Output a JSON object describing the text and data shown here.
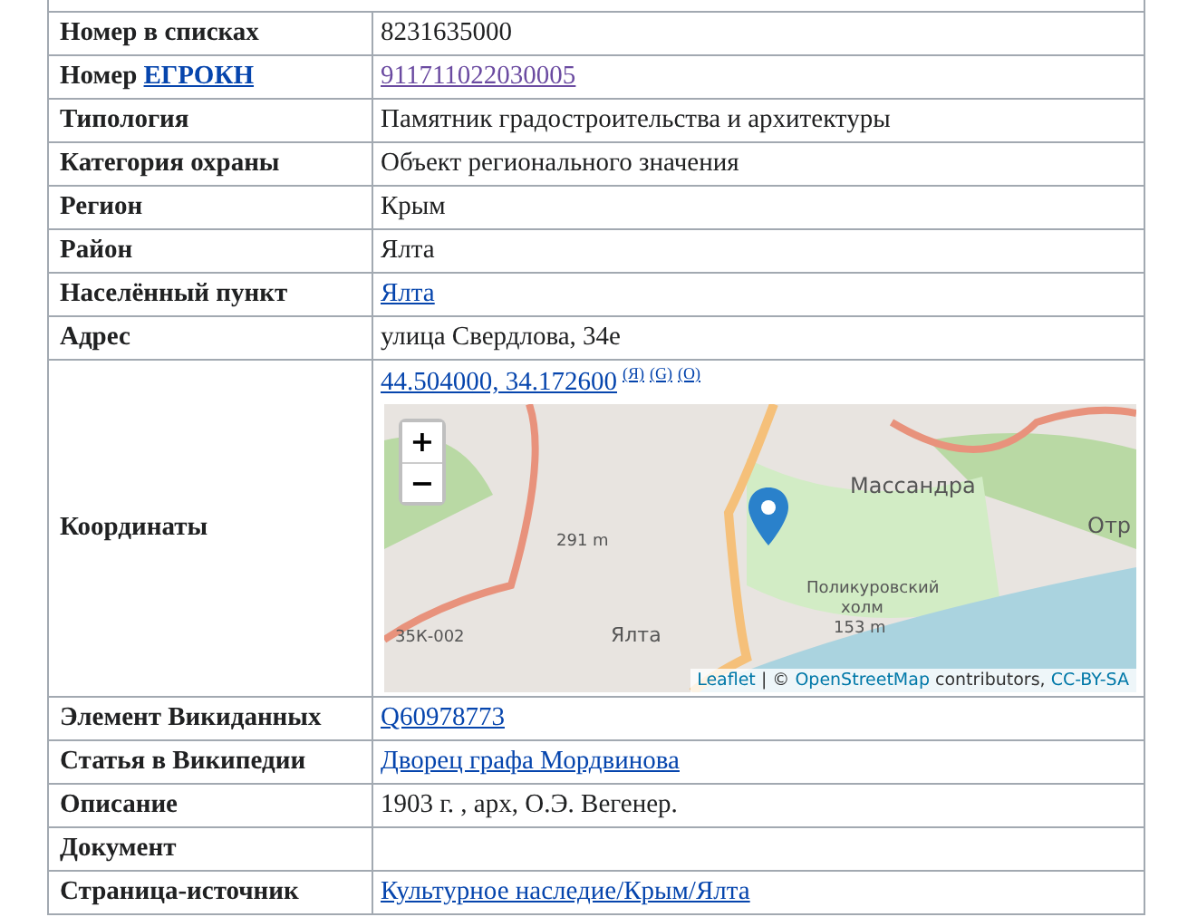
{
  "rows": [
    {
      "label": "Номер в списках",
      "kind": "text",
      "value": "8231635000"
    },
    {
      "label": "Номер ",
      "label_link": "ЕГРОКН",
      "kind": "link",
      "value": "911711022030005",
      "visited": true
    },
    {
      "label": "Типология",
      "kind": "text",
      "value": "Памятник градостроительства и архитектуры"
    },
    {
      "label": "Категория охраны",
      "kind": "text",
      "value": "Объект регионального значения"
    },
    {
      "label": "Регион",
      "kind": "text",
      "value": "Крым"
    },
    {
      "label": "Район",
      "kind": "text",
      "value": "Ялта"
    },
    {
      "label": "Населённый пункт",
      "kind": "link",
      "value": "Ялта",
      "visited": false
    },
    {
      "label": "Адрес",
      "kind": "text",
      "value": "улица Свердлова, 34е"
    },
    {
      "label": "Координаты",
      "kind": "map",
      "value": "44.504000, 34.172600",
      "sources": [
        "(Я)",
        "(G)",
        "(O)"
      ],
      "zoom_in": "+",
      "zoom_out": "−",
      "map_labels": [
        "Массандра",
        "Отр",
        "291 m",
        "Поликуровский",
        "холм",
        "153 m",
        "35К-002",
        "Ялта"
      ],
      "attribution": {
        "leaflet": "Leaflet",
        "sep": " | © ",
        "osm": "OpenStreetMap",
        "contrib": " contributors, ",
        "license": "CC-BY-SA"
      }
    },
    {
      "label": "Элемент Викиданных",
      "kind": "link",
      "value": "Q60978773",
      "visited": false
    },
    {
      "label": "Статья в Википедии",
      "kind": "link",
      "value": "Дворец графа Мордвинова",
      "visited": false
    },
    {
      "label": "Описание",
      "kind": "text",
      "value": "1903 г. , арх, О.Э. Вегенер."
    },
    {
      "label": "Документ",
      "kind": "empty"
    },
    {
      "label": "Страница-источник",
      "kind": "link",
      "value": "Культурное наследие/Крым/Ялта",
      "visited": false
    }
  ]
}
